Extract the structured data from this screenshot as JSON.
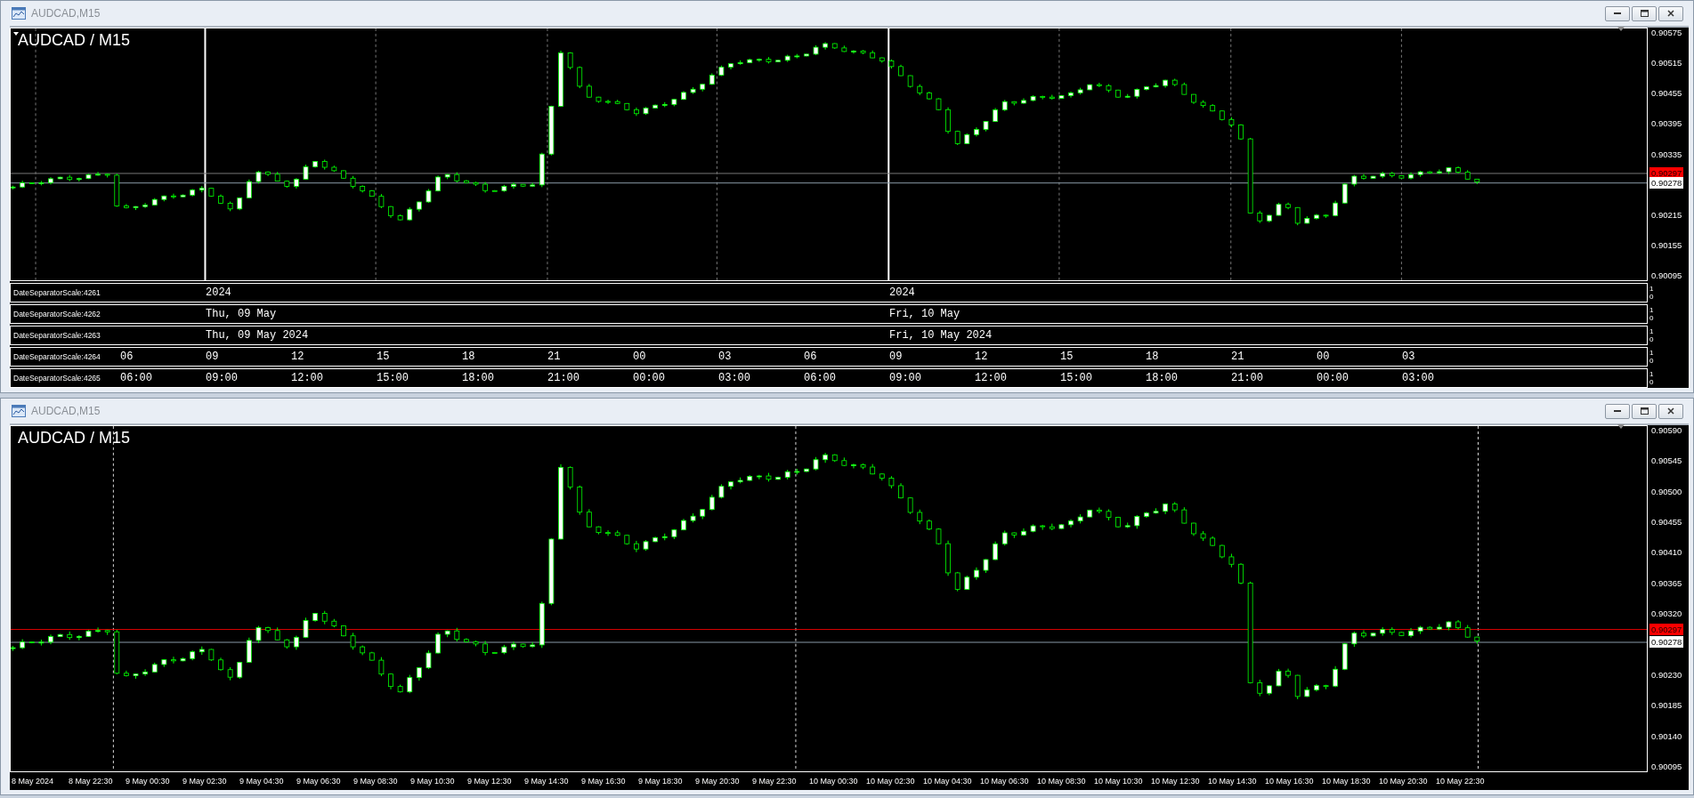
{
  "windows": [
    {
      "kind": "separators",
      "title": "AUDCAD,M15",
      "chart_label": "AUDCAD / M15",
      "price_scale": [
        "0.90575",
        "0.90515",
        "0.90455",
        "0.90395",
        "0.90335",
        "0.90215",
        "0.90155",
        "0.90095"
      ],
      "bid": "0.90297",
      "ask": "0.90278",
      "separator_rows": [
        {
          "name": "DateSeparatorScale:4261",
          "labels": [
            "2024",
            "2024"
          ],
          "scale_marks": [
            "1",
            "0"
          ]
        },
        {
          "name": "DateSeparatorScale:4262",
          "labels": [
            "Thu, 09 May",
            "Fri, 10 May"
          ],
          "scale_marks": [
            "1",
            "0"
          ]
        },
        {
          "name": "DateSeparatorScale:4263",
          "labels": [
            "Thu, 09 May 2024",
            "Fri, 10 May 2024"
          ],
          "scale_marks": [
            "1",
            "0"
          ]
        },
        {
          "name": "DateSeparatorScale:4264",
          "labels": [
            "06",
            "09",
            "12",
            "15",
            "18",
            "21",
            "00",
            "03",
            "06",
            "09",
            "12",
            "15",
            "18",
            "21",
            "00",
            "03"
          ],
          "scale_marks": [
            "1",
            "0"
          ]
        },
        {
          "name": "DateSeparatorScale:4265",
          "labels": [
            "06:00",
            "09:00",
            "12:00",
            "15:00",
            "18:00",
            "21:00",
            "00:00",
            "03:00",
            "06:00",
            "09:00",
            "12:00",
            "15:00",
            "18:00",
            "21:00",
            "00:00",
            "03:00"
          ],
          "scale_marks": [
            "1",
            "0"
          ]
        }
      ]
    },
    {
      "kind": "time_axis",
      "title": "AUDCAD,M15",
      "chart_label": "AUDCAD / M15",
      "price_scale": [
        "0.90590",
        "0.90545",
        "0.90500",
        "0.90455",
        "0.90410",
        "0.90365",
        "0.90320",
        "0.90230",
        "0.90185",
        "0.90140",
        "0.90095"
      ],
      "bid": "0.90297",
      "ask": "0.90278",
      "time_axis": [
        "8 May 2024",
        "8 May 22:30",
        "9 May 00:30",
        "9 May 02:30",
        "9 May 04:30",
        "9 May 06:30",
        "9 May 08:30",
        "9 May 10:30",
        "9 May 12:30",
        "9 May 14:30",
        "9 May 16:30",
        "9 May 18:30",
        "9 May 20:30",
        "9 May 22:30",
        "10 May 00:30",
        "10 May 02:30",
        "10 May 04:30",
        "10 May 06:30",
        "10 May 08:30",
        "10 May 10:30",
        "10 May 12:30",
        "10 May 14:30",
        "10 May 16:30",
        "10 May 18:30",
        "10 May 20:30",
        "10 May 22:30"
      ]
    }
  ]
}
